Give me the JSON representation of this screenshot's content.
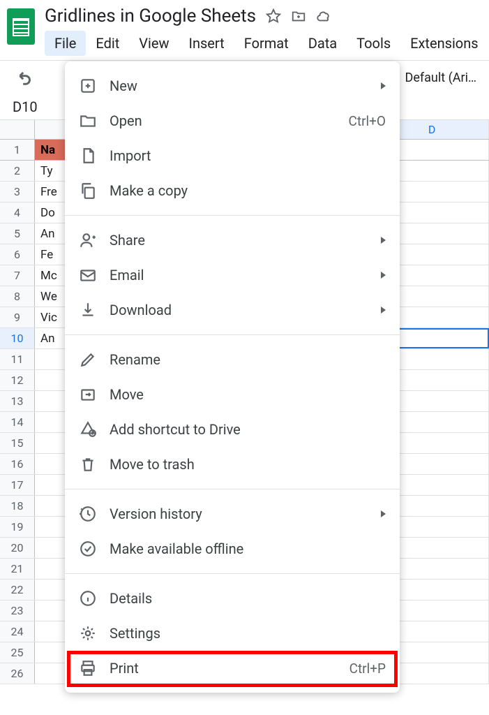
{
  "doc_title": "Gridlines in Google Sheets",
  "menu_bar": [
    "File",
    "Edit",
    "View",
    "Insert",
    "Format",
    "Data",
    "Tools",
    "Extensions"
  ],
  "font_select": "Default (Ari…",
  "cell_ref": "D10",
  "col_headers": [
    "",
    "",
    "",
    "D"
  ],
  "rows": [
    {
      "n": "1",
      "cells": [
        "Na",
        "",
        "",
        ""
      ]
    },
    {
      "n": "2",
      "cells": [
        "Ty",
        "",
        "",
        ""
      ]
    },
    {
      "n": "3",
      "cells": [
        "Fre",
        "",
        "",
        ""
      ]
    },
    {
      "n": "4",
      "cells": [
        "Do",
        "",
        "",
        ""
      ]
    },
    {
      "n": "5",
      "cells": [
        "An",
        "",
        "",
        ""
      ]
    },
    {
      "n": "6",
      "cells": [
        "Fe",
        "",
        "",
        ""
      ]
    },
    {
      "n": "7",
      "cells": [
        "Mc",
        "",
        "",
        ""
      ]
    },
    {
      "n": "8",
      "cells": [
        "We",
        "",
        "",
        ""
      ]
    },
    {
      "n": "9",
      "cells": [
        "Vic",
        "",
        "",
        ""
      ]
    },
    {
      "n": "10",
      "cells": [
        "An",
        "",
        "",
        ""
      ]
    },
    {
      "n": "11",
      "cells": [
        "",
        "",
        "",
        ""
      ]
    },
    {
      "n": "12",
      "cells": [
        "",
        "",
        "",
        ""
      ]
    },
    {
      "n": "13",
      "cells": [
        "",
        "",
        "",
        ""
      ]
    },
    {
      "n": "14",
      "cells": [
        "",
        "",
        "",
        ""
      ]
    },
    {
      "n": "15",
      "cells": [
        "",
        "",
        "",
        ""
      ]
    },
    {
      "n": "16",
      "cells": [
        "",
        "",
        "",
        ""
      ]
    },
    {
      "n": "17",
      "cells": [
        "",
        "",
        "",
        ""
      ]
    },
    {
      "n": "18",
      "cells": [
        "",
        "",
        "",
        ""
      ]
    },
    {
      "n": "19",
      "cells": [
        "",
        "",
        "",
        ""
      ]
    },
    {
      "n": "20",
      "cells": [
        "",
        "",
        "",
        ""
      ]
    },
    {
      "n": "21",
      "cells": [
        "",
        "",
        "",
        ""
      ]
    },
    {
      "n": "22",
      "cells": [
        "",
        "",
        "",
        ""
      ]
    },
    {
      "n": "23",
      "cells": [
        "",
        "",
        "",
        ""
      ]
    },
    {
      "n": "24",
      "cells": [
        "",
        "",
        "",
        ""
      ]
    },
    {
      "n": "25",
      "cells": [
        "",
        "",
        "",
        ""
      ]
    },
    {
      "n": "26",
      "cells": [
        "",
        "",
        "",
        ""
      ]
    }
  ],
  "dropdown": {
    "sections": [
      [
        {
          "icon": "plus-box",
          "label": "New",
          "arrow": true
        },
        {
          "icon": "folder",
          "label": "Open",
          "shortcut": "Ctrl+O"
        },
        {
          "icon": "file",
          "label": "Import"
        },
        {
          "icon": "copy",
          "label": "Make a copy"
        }
      ],
      [
        {
          "icon": "person-plus",
          "label": "Share",
          "arrow": true
        },
        {
          "icon": "mail",
          "label": "Email",
          "arrow": true
        },
        {
          "icon": "download",
          "label": "Download",
          "arrow": true
        }
      ],
      [
        {
          "icon": "pencil",
          "label": "Rename"
        },
        {
          "icon": "move",
          "label": "Move"
        },
        {
          "icon": "drive-plus",
          "label": "Add shortcut to Drive"
        },
        {
          "icon": "trash",
          "label": "Move to trash"
        }
      ],
      [
        {
          "icon": "history",
          "label": "Version history",
          "arrow": true
        },
        {
          "icon": "offline",
          "label": "Make available offline"
        }
      ],
      [
        {
          "icon": "info",
          "label": "Details"
        },
        {
          "icon": "gear",
          "label": "Settings"
        },
        {
          "icon": "print",
          "label": "Print",
          "shortcut": "Ctrl+P"
        }
      ]
    ]
  }
}
